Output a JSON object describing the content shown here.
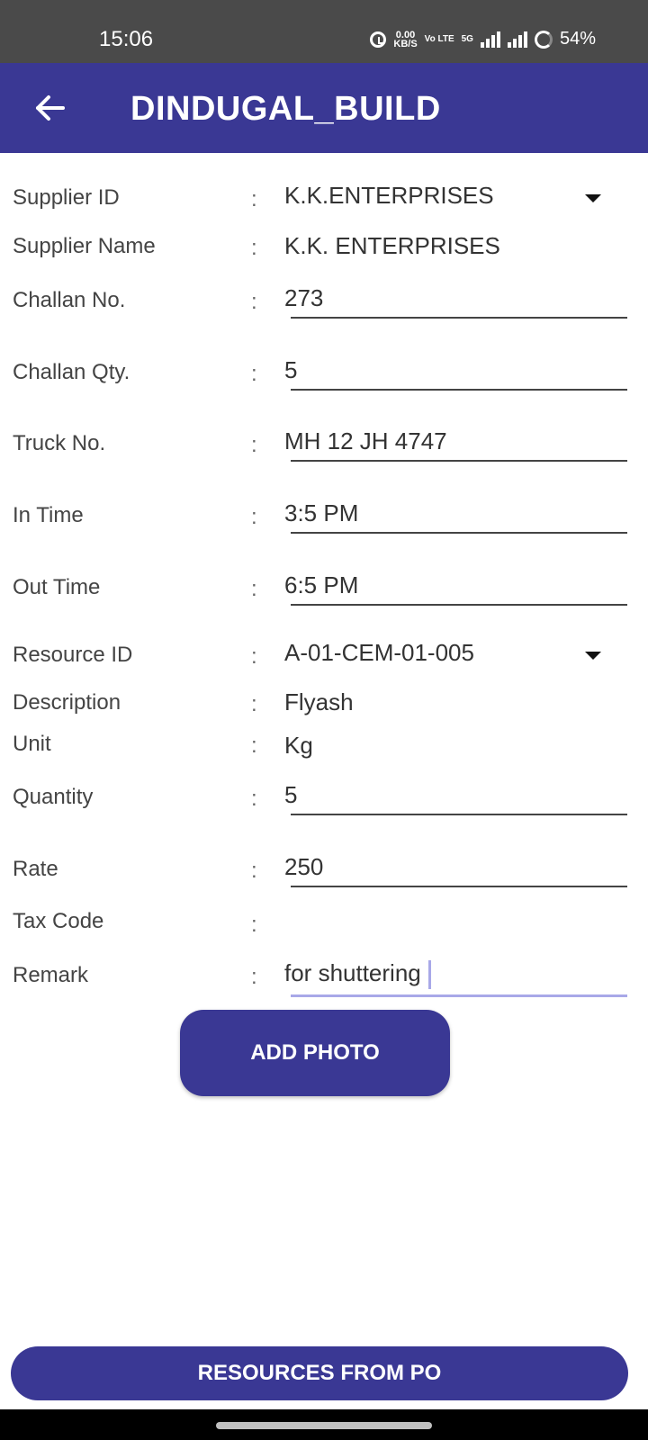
{
  "status_bar": {
    "time": "15:06",
    "net_speed_value": "0.00",
    "net_speed_unit": "KB/S",
    "volte": "Vo LTE",
    "network": "5G",
    "battery": "54%"
  },
  "app_bar": {
    "back_icon": "arrow-left-icon",
    "title": "DINDUGAL_BUILD"
  },
  "form": {
    "colon": ":",
    "supplier_id": {
      "label": "Supplier ID",
      "value": "K.K.ENTERPRISES"
    },
    "supplier_name": {
      "label": "Supplier Name",
      "value": "K.K. ENTERPRISES"
    },
    "challan_no": {
      "label": "Challan No.",
      "value": "273"
    },
    "challan_qty": {
      "label": "Challan Qty.",
      "value": "5"
    },
    "truck_no": {
      "label": "Truck No.",
      "value": "MH 12 JH 4747"
    },
    "in_time": {
      "label": "In Time",
      "value": "3:5 PM"
    },
    "out_time": {
      "label": "Out Time",
      "value": "6:5 PM"
    },
    "resource_id": {
      "label": "Resource ID",
      "value": "A-01-CEM-01-005"
    },
    "description": {
      "label": "Description",
      "value": "Flyash"
    },
    "unit": {
      "label": "Unit",
      "value": "Kg"
    },
    "quantity": {
      "label": "Quantity",
      "value": "5"
    },
    "rate": {
      "label": "Rate",
      "value": "250"
    },
    "tax_code": {
      "label": "Tax Code",
      "value": ""
    },
    "remark": {
      "label": "Remark",
      "value": "for shuttering"
    }
  },
  "buttons": {
    "add_photo": "ADD PHOTO",
    "resources_from_po": "RESOURCES FROM PO"
  },
  "colors": {
    "primary": "#3a3894",
    "status_bar": "#4a4a4a",
    "focus_line": "#a8a8e8"
  }
}
